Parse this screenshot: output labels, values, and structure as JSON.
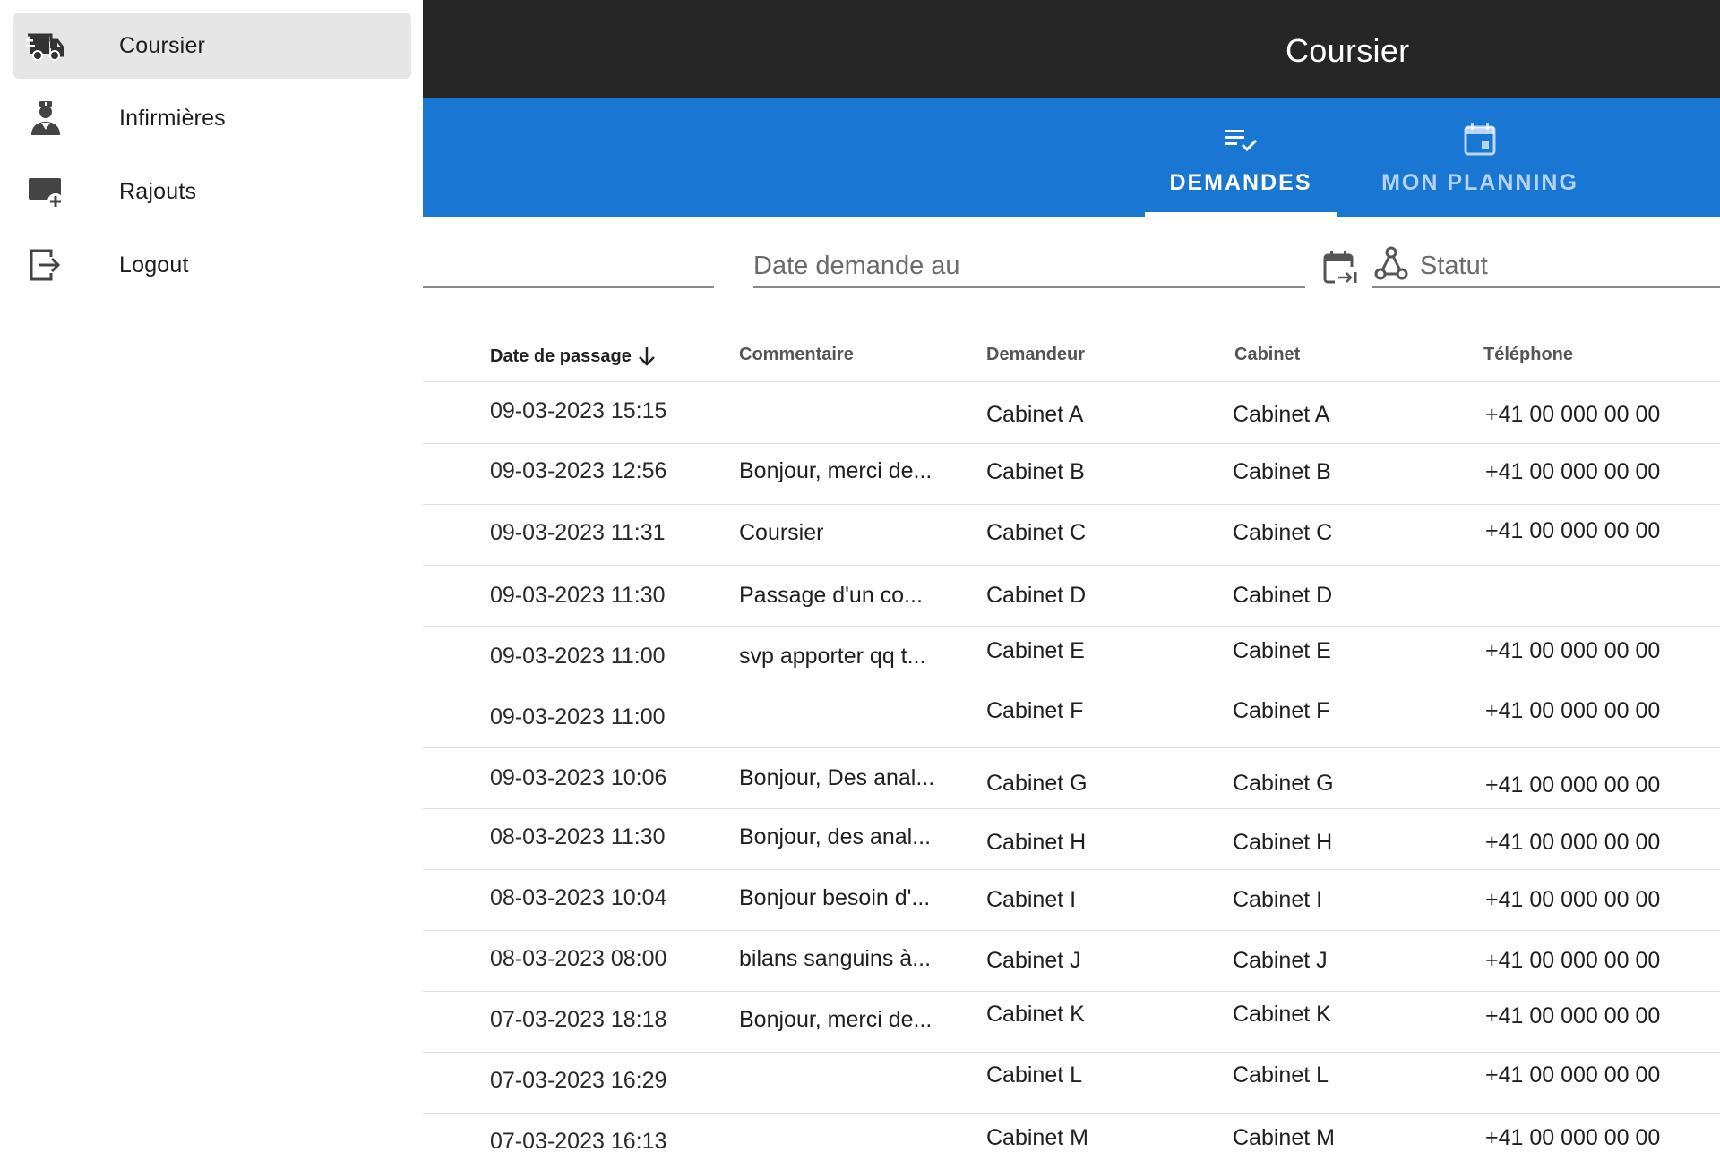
{
  "drawer": {
    "items": [
      {
        "label": "Coursier",
        "icon": "truck-icon",
        "active": true
      },
      {
        "label": "Infirmières",
        "icon": "nurse-icon",
        "active": false
      },
      {
        "label": "Rajouts",
        "icon": "add-to-queue-icon",
        "active": false
      },
      {
        "label": "Logout",
        "icon": "logout-icon",
        "active": false
      }
    ]
  },
  "appbar": {
    "title": "Coursier"
  },
  "tabs": [
    {
      "label": "DEMANDES",
      "icon": "checklist-icon",
      "active": true
    },
    {
      "label": "MON PLANNING",
      "icon": "calendar-icon",
      "active": false
    }
  ],
  "filters": {
    "date_to_placeholder": "Date demande au",
    "status_placeholder": "Statut"
  },
  "table": {
    "columns": [
      "Date de passage",
      "Commentaire",
      "Demandeur",
      "Cabinet",
      "Téléphone"
    ],
    "sorted_column": "Date de passage",
    "rows": [
      {
        "date": "09-03-2023 15:15",
        "comment": "",
        "requester": "Cabinet A",
        "cabinet": "Cabinet A",
        "phone": "+41 00 000 00 00"
      },
      {
        "date": "09-03-2023 12:56",
        "comment": "Bonjour, merci de...",
        "requester": "Cabinet B",
        "cabinet": "Cabinet B",
        "phone": "+41 00 000 00 00"
      },
      {
        "date": "09-03-2023 11:31",
        "comment": "Coursier",
        "requester": "Cabinet C",
        "cabinet": "Cabinet C",
        "phone": "+41 00 000 00 00"
      },
      {
        "date": "09-03-2023 11:30",
        "comment": "Passage d'un co...",
        "requester": "Cabinet D",
        "cabinet": "Cabinet D",
        "phone": ""
      },
      {
        "date": "09-03-2023 11:00",
        "comment": "svp apporter qq t...",
        "requester": "Cabinet E",
        "cabinet": "Cabinet E",
        "phone": "+41 00 000 00 00"
      },
      {
        "date": "09-03-2023 11:00",
        "comment": "",
        "requester": "Cabinet F",
        "cabinet": "Cabinet F",
        "phone": "+41 00 000 00 00"
      },
      {
        "date": "09-03-2023 10:06",
        "comment": "Bonjour, Des anal...",
        "requester": "Cabinet G",
        "cabinet": "Cabinet G",
        "phone": "+41 00 000 00 00"
      },
      {
        "date": "08-03-2023 11:30",
        "comment": "Bonjour, des anal...",
        "requester": "Cabinet H",
        "cabinet": "Cabinet H",
        "phone": "+41 00 000 00 00"
      },
      {
        "date": "08-03-2023 10:04",
        "comment": "Bonjour besoin d'...",
        "requester": "Cabinet I",
        "cabinet": "Cabinet I",
        "phone": "+41 00 000 00 00"
      },
      {
        "date": "08-03-2023 08:00",
        "comment": "bilans sanguins à...",
        "requester": "Cabinet J",
        "cabinet": "Cabinet J",
        "phone": "+41 00 000 00 00"
      },
      {
        "date": "07-03-2023 18:18",
        "comment": "Bonjour, merci de...",
        "requester": "Cabinet K",
        "cabinet": "Cabinet K",
        "phone": "+41 00 000 00 00"
      },
      {
        "date": "07-03-2023 16:29",
        "comment": "",
        "requester": "Cabinet L",
        "cabinet": "Cabinet L",
        "phone": "+41 00 000 00 00"
      },
      {
        "date": "07-03-2023 16:13",
        "comment": "",
        "requester": "Cabinet M",
        "cabinet": "Cabinet M",
        "phone": "+41 00 000 00 00"
      }
    ]
  },
  "colors": {
    "appbar": "#262626",
    "tabbar": "#1976d2",
    "drawer_active": "#e6e6e6"
  }
}
